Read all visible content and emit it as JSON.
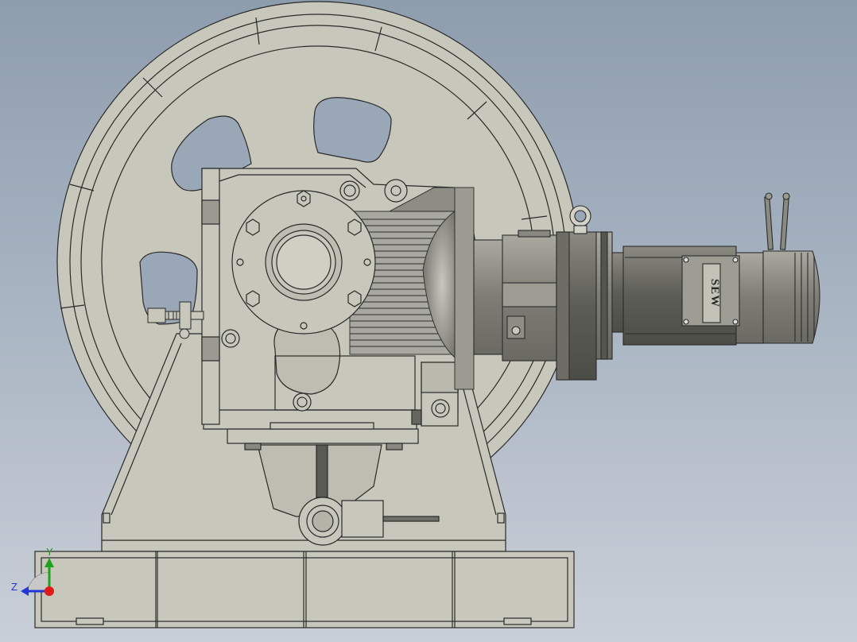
{
  "viewport": {
    "background_top": "#8e9dae",
    "background_bottom": "#c9cfd8",
    "part_color": "#c7c7bb",
    "motor_color": "#8e8e85",
    "edge_color": "#2a2a2a"
  },
  "motor": {
    "nameplate_text": "SEW"
  },
  "triad": {
    "y_label": "Y",
    "z_label": "Z",
    "y_color": "#1fa01f",
    "z_color": "#2136d6",
    "x_color": "#e01919"
  }
}
